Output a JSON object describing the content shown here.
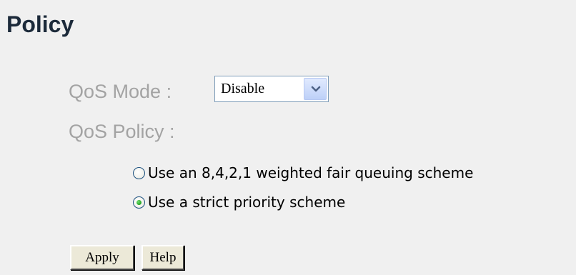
{
  "page": {
    "title": "Policy"
  },
  "qos_mode": {
    "label": "QoS Mode :",
    "selected": "Disable",
    "options": [
      "Disable"
    ]
  },
  "qos_policy": {
    "label": "QoS Policy :",
    "options": [
      {
        "label": "Use an 8,4,2,1 weighted fair queuing scheme",
        "checked": false
      },
      {
        "label": "Use a strict priority scheme",
        "checked": true
      }
    ]
  },
  "buttons": {
    "apply": "Apply",
    "help": "Help"
  },
  "colors": {
    "background": "#f0f0f0",
    "title": "#1c2a3a",
    "field_label": "#a3a3a3",
    "radio_dot": "#21a121"
  },
  "icons": {
    "select_arrow": "chevron-down-icon"
  }
}
